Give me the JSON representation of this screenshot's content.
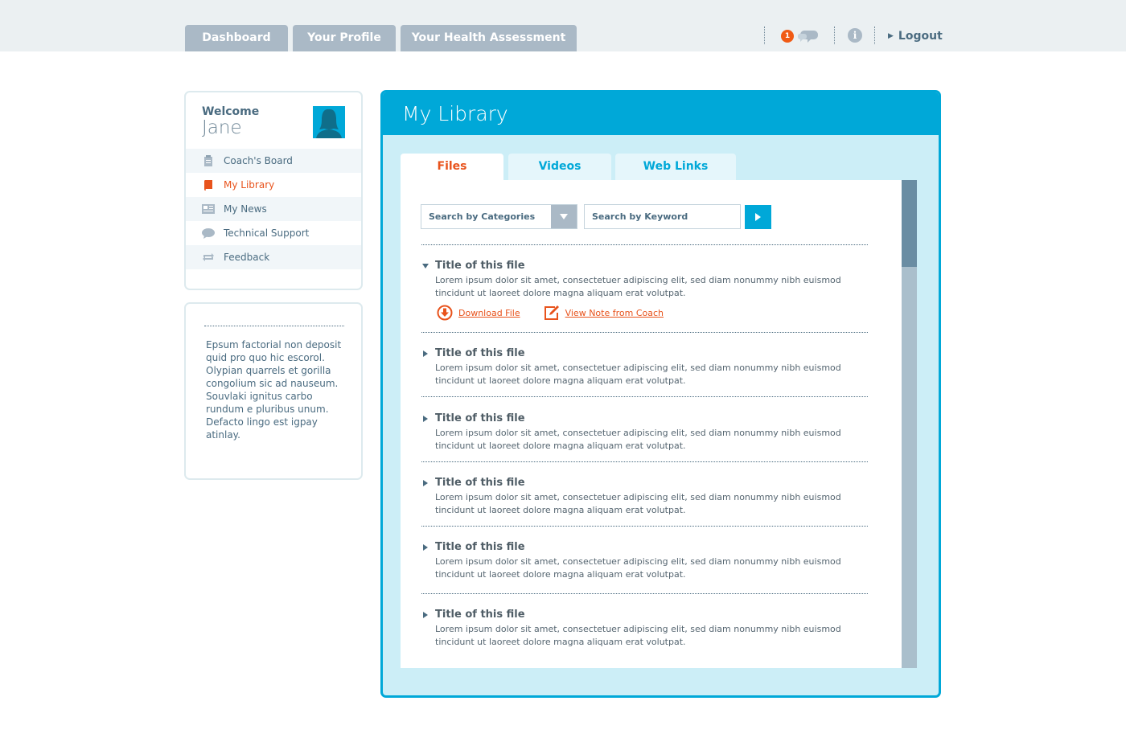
{
  "topnav": {
    "tabs": [
      {
        "label": "Dashboard"
      },
      {
        "label": "Your Profile"
      },
      {
        "label": "Your Health Assessment"
      }
    ],
    "notification_count": "1",
    "info_glyph": "i",
    "logout_label": "Logout",
    "icons": {
      "messages": "chat-bubbles-icon",
      "info": "info-icon",
      "logout_arrow": "play-arrow-icon"
    }
  },
  "sidebar": {
    "welcome": "Welcome",
    "user_name": "Jane",
    "nav": [
      {
        "label": "Coach's Board",
        "icon": "clipboard-icon"
      },
      {
        "label": "My Library",
        "icon": "book-icon",
        "active": true
      },
      {
        "label": "My News",
        "icon": "newspaper-icon"
      },
      {
        "label": "Technical Support",
        "icon": "speech-bubble-icon"
      },
      {
        "label": "Feedback",
        "icon": "repeat-arrows-icon"
      }
    ],
    "blurb": "Epsum factorial non deposit quid pro quo hic escorol. Olypian quarrels et gorilla congolium sic ad nauseum. Souvlaki ignitus carbo rundum e pluribus unum. Defacto lingo est igpay atinlay."
  },
  "library": {
    "title": "My Library",
    "tabs": [
      {
        "label": "Files",
        "active": true
      },
      {
        "label": "Videos"
      },
      {
        "label": "Web Links"
      }
    ],
    "category_select": "Search by Categories",
    "keyword_placeholder": "Search by Keyword",
    "files": [
      {
        "title": "Title of this file",
        "desc": "Lorem ipsum dolor sit amet, consectetuer adipiscing elit, sed diam nonummy nibh euismod tincidunt ut laoreet dolore magna aliquam erat volutpat.",
        "expanded": true,
        "download_label": "Download File",
        "note_label": "View Note from Coach"
      },
      {
        "title": "Title of this file",
        "desc": "Lorem ipsum dolor sit amet, consectetuer adipiscing elit, sed diam nonummy nibh euismod tincidunt ut laoreet dolore magna aliquam erat volutpat."
      },
      {
        "title": "Title of this file",
        "desc": "Lorem ipsum dolor sit amet, consectetuer adipiscing elit, sed diam nonummy nibh euismod tincidunt ut laoreet dolore magna aliquam erat volutpat."
      },
      {
        "title": "Title of this file",
        "desc": "Lorem ipsum dolor sit amet, consectetuer adipiscing elit, sed diam nonummy nibh euismod tincidunt ut laoreet dolore magna aliquam erat volutpat."
      },
      {
        "title": "Title of this file",
        "desc": "Lorem ipsum dolor sit amet, consectetuer adipiscing elit, sed diam nonummy nibh euismod tincidunt ut laoreet dolore magna aliquam erat volutpat."
      },
      {
        "title": "Title of this file",
        "desc": "Lorem ipsum dolor sit amet, consectetuer adipiscing elit, sed diam nonummy nibh euismod tincidunt ut laoreet dolore magna aliquam erat volutpat."
      }
    ]
  },
  "colors": {
    "accent": "#00a8d8",
    "active": "#e8531c",
    "tab_gray": "#aab9c6",
    "panel_bg": "#cceef7",
    "text": "#4a6b80"
  }
}
